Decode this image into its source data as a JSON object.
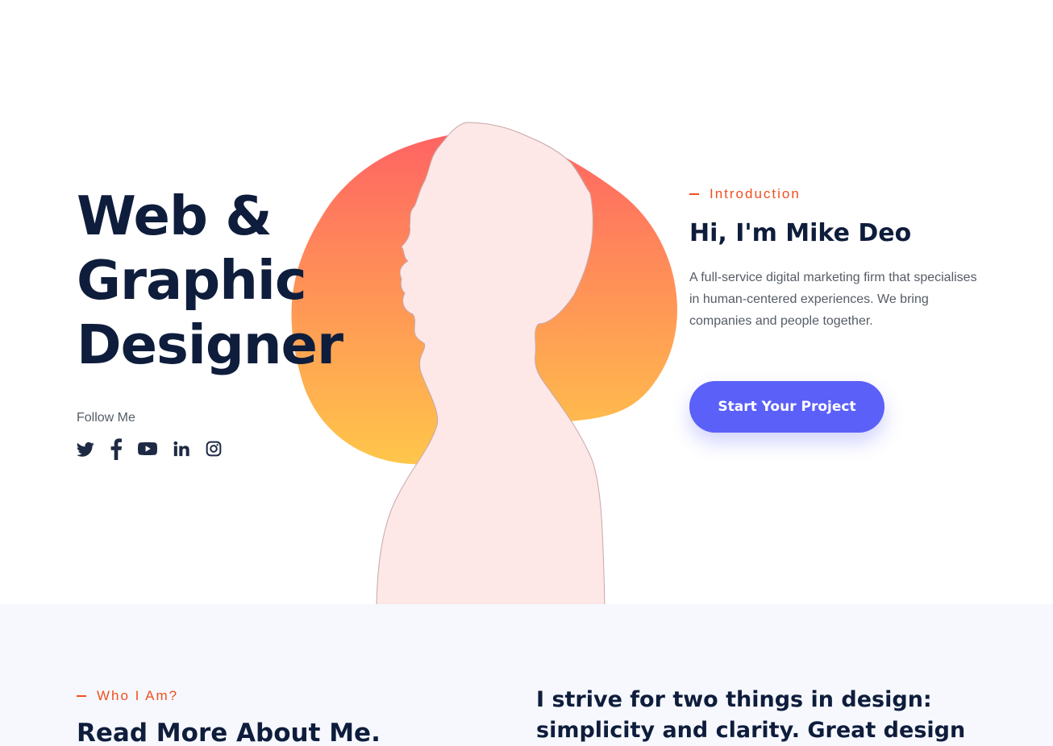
{
  "hero": {
    "title_lines": [
      "Web &",
      "Graphic",
      "Designer"
    ],
    "follow_label": "Follow Me",
    "socials": [
      {
        "icon": "twitter-icon",
        "label": "Twitter"
      },
      {
        "icon": "facebook-icon",
        "label": "Facebook"
      },
      {
        "icon": "youtube-icon",
        "label": "YouTube"
      },
      {
        "icon": "linkedin-icon",
        "label": "LinkedIn"
      },
      {
        "icon": "instagram-icon",
        "label": "Instagram"
      }
    ],
    "portrait_image": "silhouette-portrait",
    "intro": {
      "tag": "Introduction",
      "heading": "Hi, I'm Mike Deo",
      "description": "A full-service digital marketing firm that specialises in human-centered experiences. We bring companies and people together.",
      "cta_label": "Start Your Project"
    }
  },
  "about": {
    "tag": "Who I Am?",
    "heading": "Read More About Me.",
    "quote": "I strive for two things in design: simplicity and clarity. Great design is"
  },
  "colors": {
    "navy_text": "#0f1d3c",
    "accent_orange": "#f24e1e",
    "button_blue": "#5b60f8",
    "blob_top": "#ff6363",
    "blob_bottom": "#ffc64a",
    "silhouette": "#fde7e7",
    "about_background": "#f6f8fe"
  }
}
